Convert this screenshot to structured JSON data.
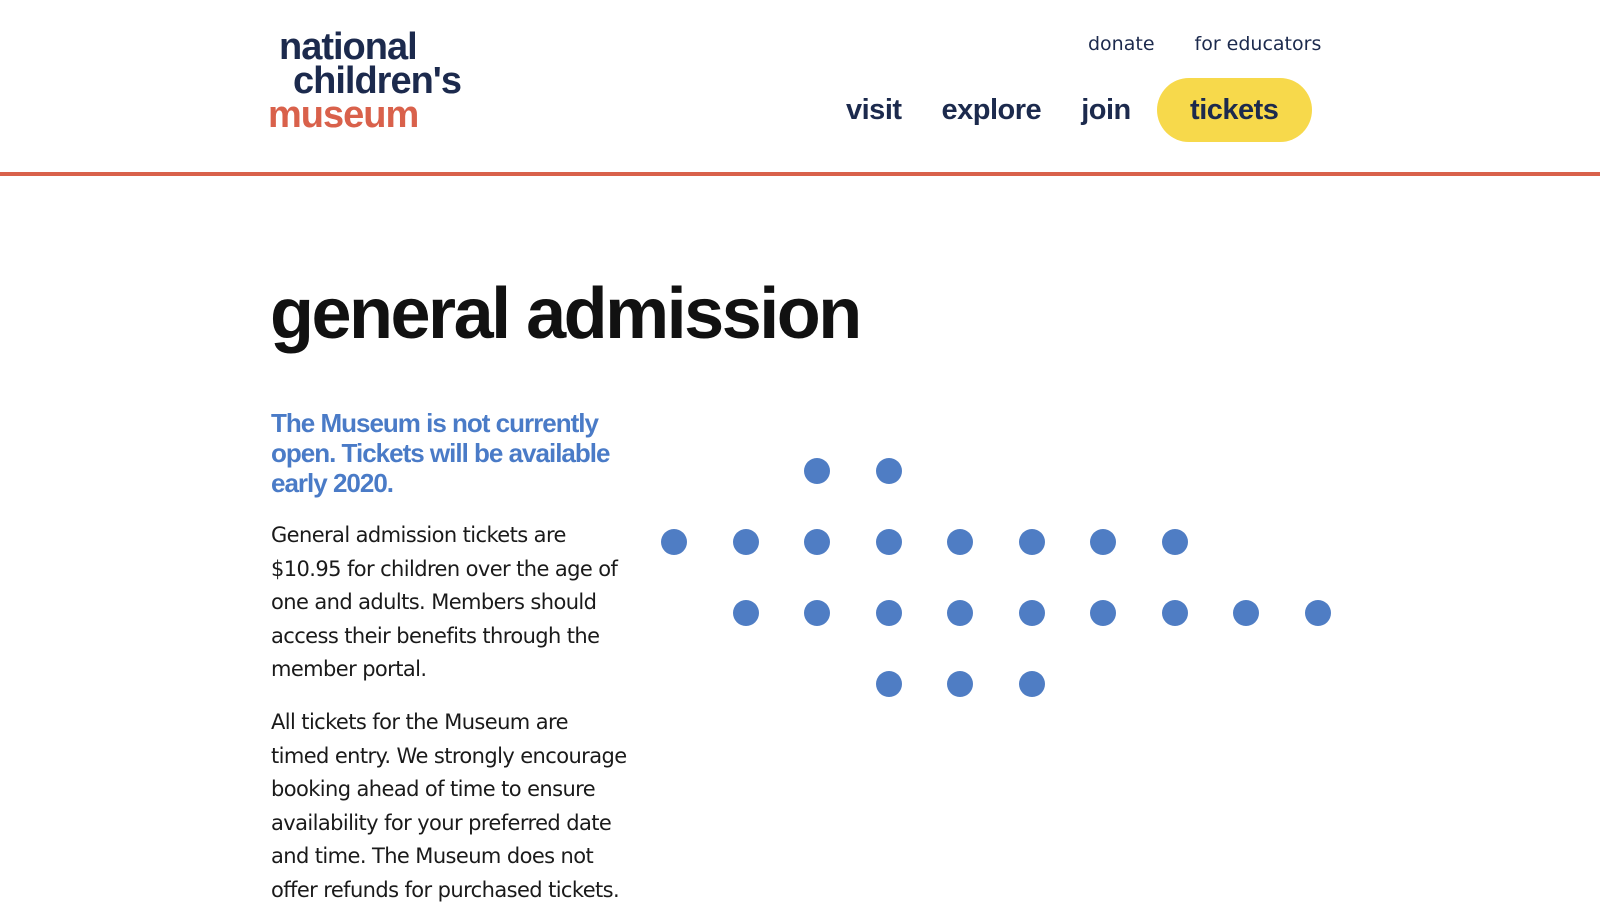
{
  "logo": {
    "line1": "national",
    "line2": "children's",
    "line3": "museum"
  },
  "utility_nav": [
    {
      "label": "donate"
    },
    {
      "label": "for educators"
    }
  ],
  "main_nav": [
    {
      "label": "visit"
    },
    {
      "label": "explore"
    },
    {
      "label": "join"
    }
  ],
  "tickets_button": {
    "label": "tickets"
  },
  "page": {
    "title": "general admission",
    "notice": "The Museum is not currently open. Tickets will be available early 2020.",
    "paragraphs": [
      "General admission tickets are $10.95 for children over the age of one and adults. Members should access their benefits through the member portal.",
      "All tickets for the Museum are timed entry. We strongly encourage booking ahead of time to ensure availability for your preferred date and time. The Museum does not offer refunds for purchased tickets."
    ]
  },
  "colors": {
    "brand_navy": "#1c2a4d",
    "brand_red": "#d9614b",
    "accent_yellow": "#f7d94b",
    "accent_blue": "#4f7dc4"
  }
}
